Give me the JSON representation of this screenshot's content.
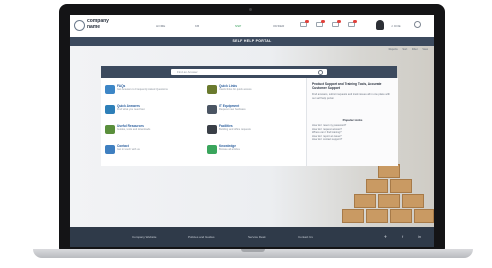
{
  "brand": {
    "line1": "company",
    "line2": "name"
  },
  "nav": [
    {
      "label": "HOME",
      "active": false
    },
    {
      "label": "KB",
      "active": false
    },
    {
      "label": "SSP",
      "active": true
    },
    {
      "label": "ORDER",
      "active": false
    }
  ],
  "header_icons": [
    "inbox-icon",
    "alert-icon",
    "ticket-icon",
    "calendar-icon"
  ],
  "user": {
    "name": "J. DOE"
  },
  "portal_title": "SELF HELP PORTAL",
  "toolbar": {
    "items": [
      "Reports",
      "Sort",
      "Filter",
      "View"
    ]
  },
  "search": {
    "placeholder": "Find an Answer"
  },
  "tiles": [
    {
      "name": "FAQs",
      "desc": "Get Answers to Frequently Asked Questions",
      "color": "#3d86c6"
    },
    {
      "name": "Quick Answers",
      "desc": "Find what you need fast",
      "color": "#2e7fb8"
    },
    {
      "name": "Useful Resources",
      "desc": "Guides, tools and downloads",
      "color": "#5a8f3c"
    },
    {
      "name": "Contact",
      "desc": "Get in touch with us",
      "color": "#3f7fc0"
    },
    {
      "name": "Quick Links",
      "desc": "Useful links for quick access",
      "color": "#6a7a2e"
    },
    {
      "name": "IT Equipment",
      "desc": "Request new hardware",
      "color": "#4b5563"
    },
    {
      "name": "Facilities",
      "desc": "Building and office requests",
      "color": "#3a3f47"
    },
    {
      "name": "Knowledge",
      "desc": "Browse all articles",
      "color": "#3aa55c"
    }
  ],
  "sidebar": {
    "heading": "Product Support and Training Tools, Accurate Customer Support",
    "paragraph": "Find answers, submit requests and track issues all in one place with our self help portal.",
    "subheading": "Popular Links",
    "links": [
      "How do I reset my password?",
      "How do I request access?",
      "Where can I find training?",
      "How do I report an issue?",
      "How do I contact support?"
    ]
  },
  "footer": {
    "links": [
      "Company Website",
      "Policies and Guides",
      "Service Desk",
      "Contact Us"
    ],
    "social_icons": [
      "twitter-icon",
      "facebook-icon",
      "linkedin-icon"
    ]
  }
}
